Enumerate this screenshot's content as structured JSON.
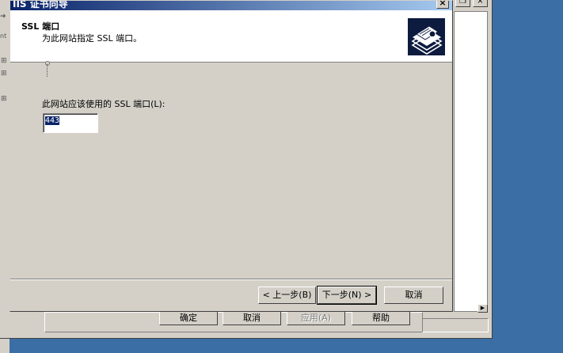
{
  "background_window": {
    "tree_label_fragment": "nt",
    "buttons": [
      {
        "label": "确定",
        "enabled": true
      },
      {
        "label": "取消",
        "enabled": true
      },
      {
        "label": "应用(A)",
        "enabled": false
      },
      {
        "label": "帮助",
        "enabled": true
      }
    ],
    "scroll_arrow_icon": "arrow-right-icon"
  },
  "wizard": {
    "title": "IIS 证书向导",
    "close_glyph": "×",
    "header": {
      "title": "SSL 端口",
      "subtitle": "为此网站指定 SSL 端口。",
      "icon": "certificate-icon"
    },
    "port_label": "此网站应该使用的 SSL 端口(L):",
    "port_value": "443",
    "buttons": {
      "back": "< 上一步(B)",
      "next": "下一步(N) >",
      "cancel": "取消"
    }
  },
  "colors": {
    "desktop": "#3a6ea5",
    "title_bar": "#0a246a",
    "dialog_face": "#d4d0c8"
  }
}
